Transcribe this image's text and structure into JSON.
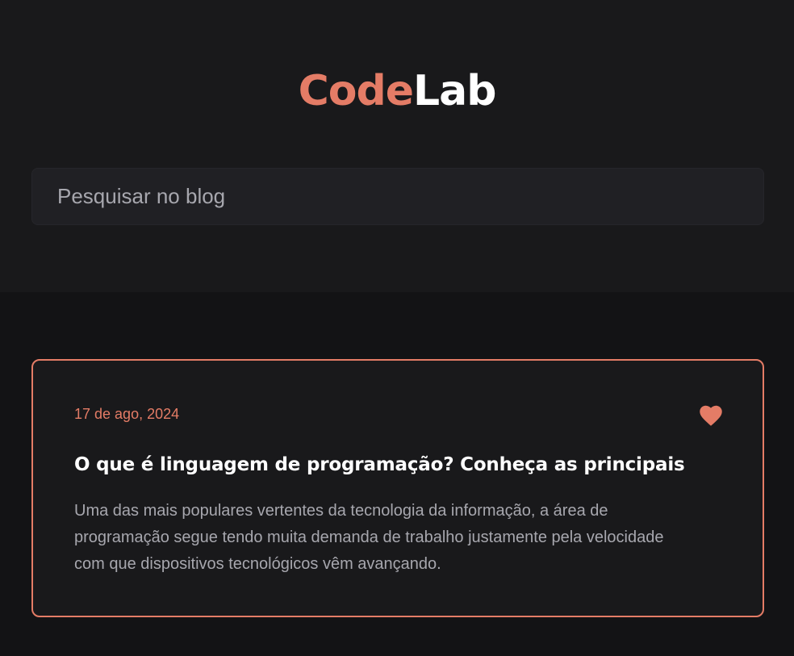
{
  "brand": {
    "logo_part1": "Code",
    "logo_part2": "Lab",
    "accent_color": "#e47c66"
  },
  "search": {
    "placeholder": "Pesquisar no blog",
    "value": ""
  },
  "posts": [
    {
      "date": "17 de ago, 2024",
      "title": "O que é linguagem de programação? Conheça as principais",
      "excerpt": "Uma das mais populares vertentes da tecnologia da informação, a área de programação segue tendo muita demanda de trabalho justamente pela velocidade com que dispositivos tecnológicos vêm avançando.",
      "favorite_icon": "heart-icon",
      "favorited": true
    }
  ]
}
